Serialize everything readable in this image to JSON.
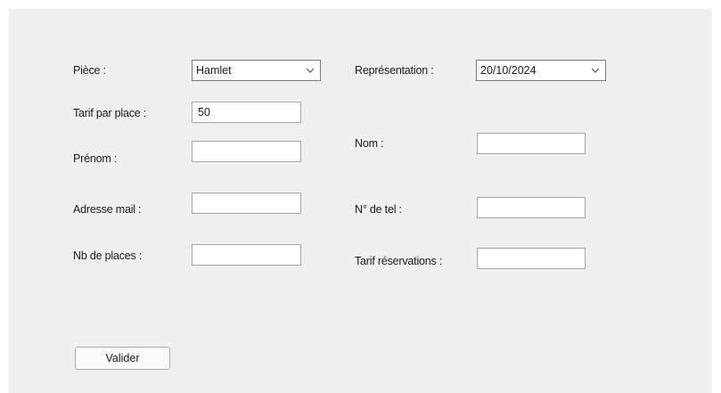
{
  "form": {
    "piece": {
      "label": "Pièce :",
      "selected": "Hamlet",
      "icon": "chevron-down-icon"
    },
    "representation": {
      "label": "Représentation :",
      "selected": "20/10/2024",
      "icon": "chevron-down-icon"
    },
    "tarif_place": {
      "label": "Tarif par place :",
      "value": "50"
    },
    "prenom": {
      "label": "Prénom :",
      "value": ""
    },
    "nom": {
      "label": "Nom :",
      "value": ""
    },
    "adresse_mail": {
      "label": "Adresse mail :",
      "value": ""
    },
    "telephone": {
      "label": "N° de tel :",
      "value": ""
    },
    "nb_places": {
      "label": "Nb de places :",
      "value": ""
    },
    "tarif_reservations": {
      "label": "Tarif réservations :",
      "value": ""
    },
    "submit_label": "Valider"
  }
}
